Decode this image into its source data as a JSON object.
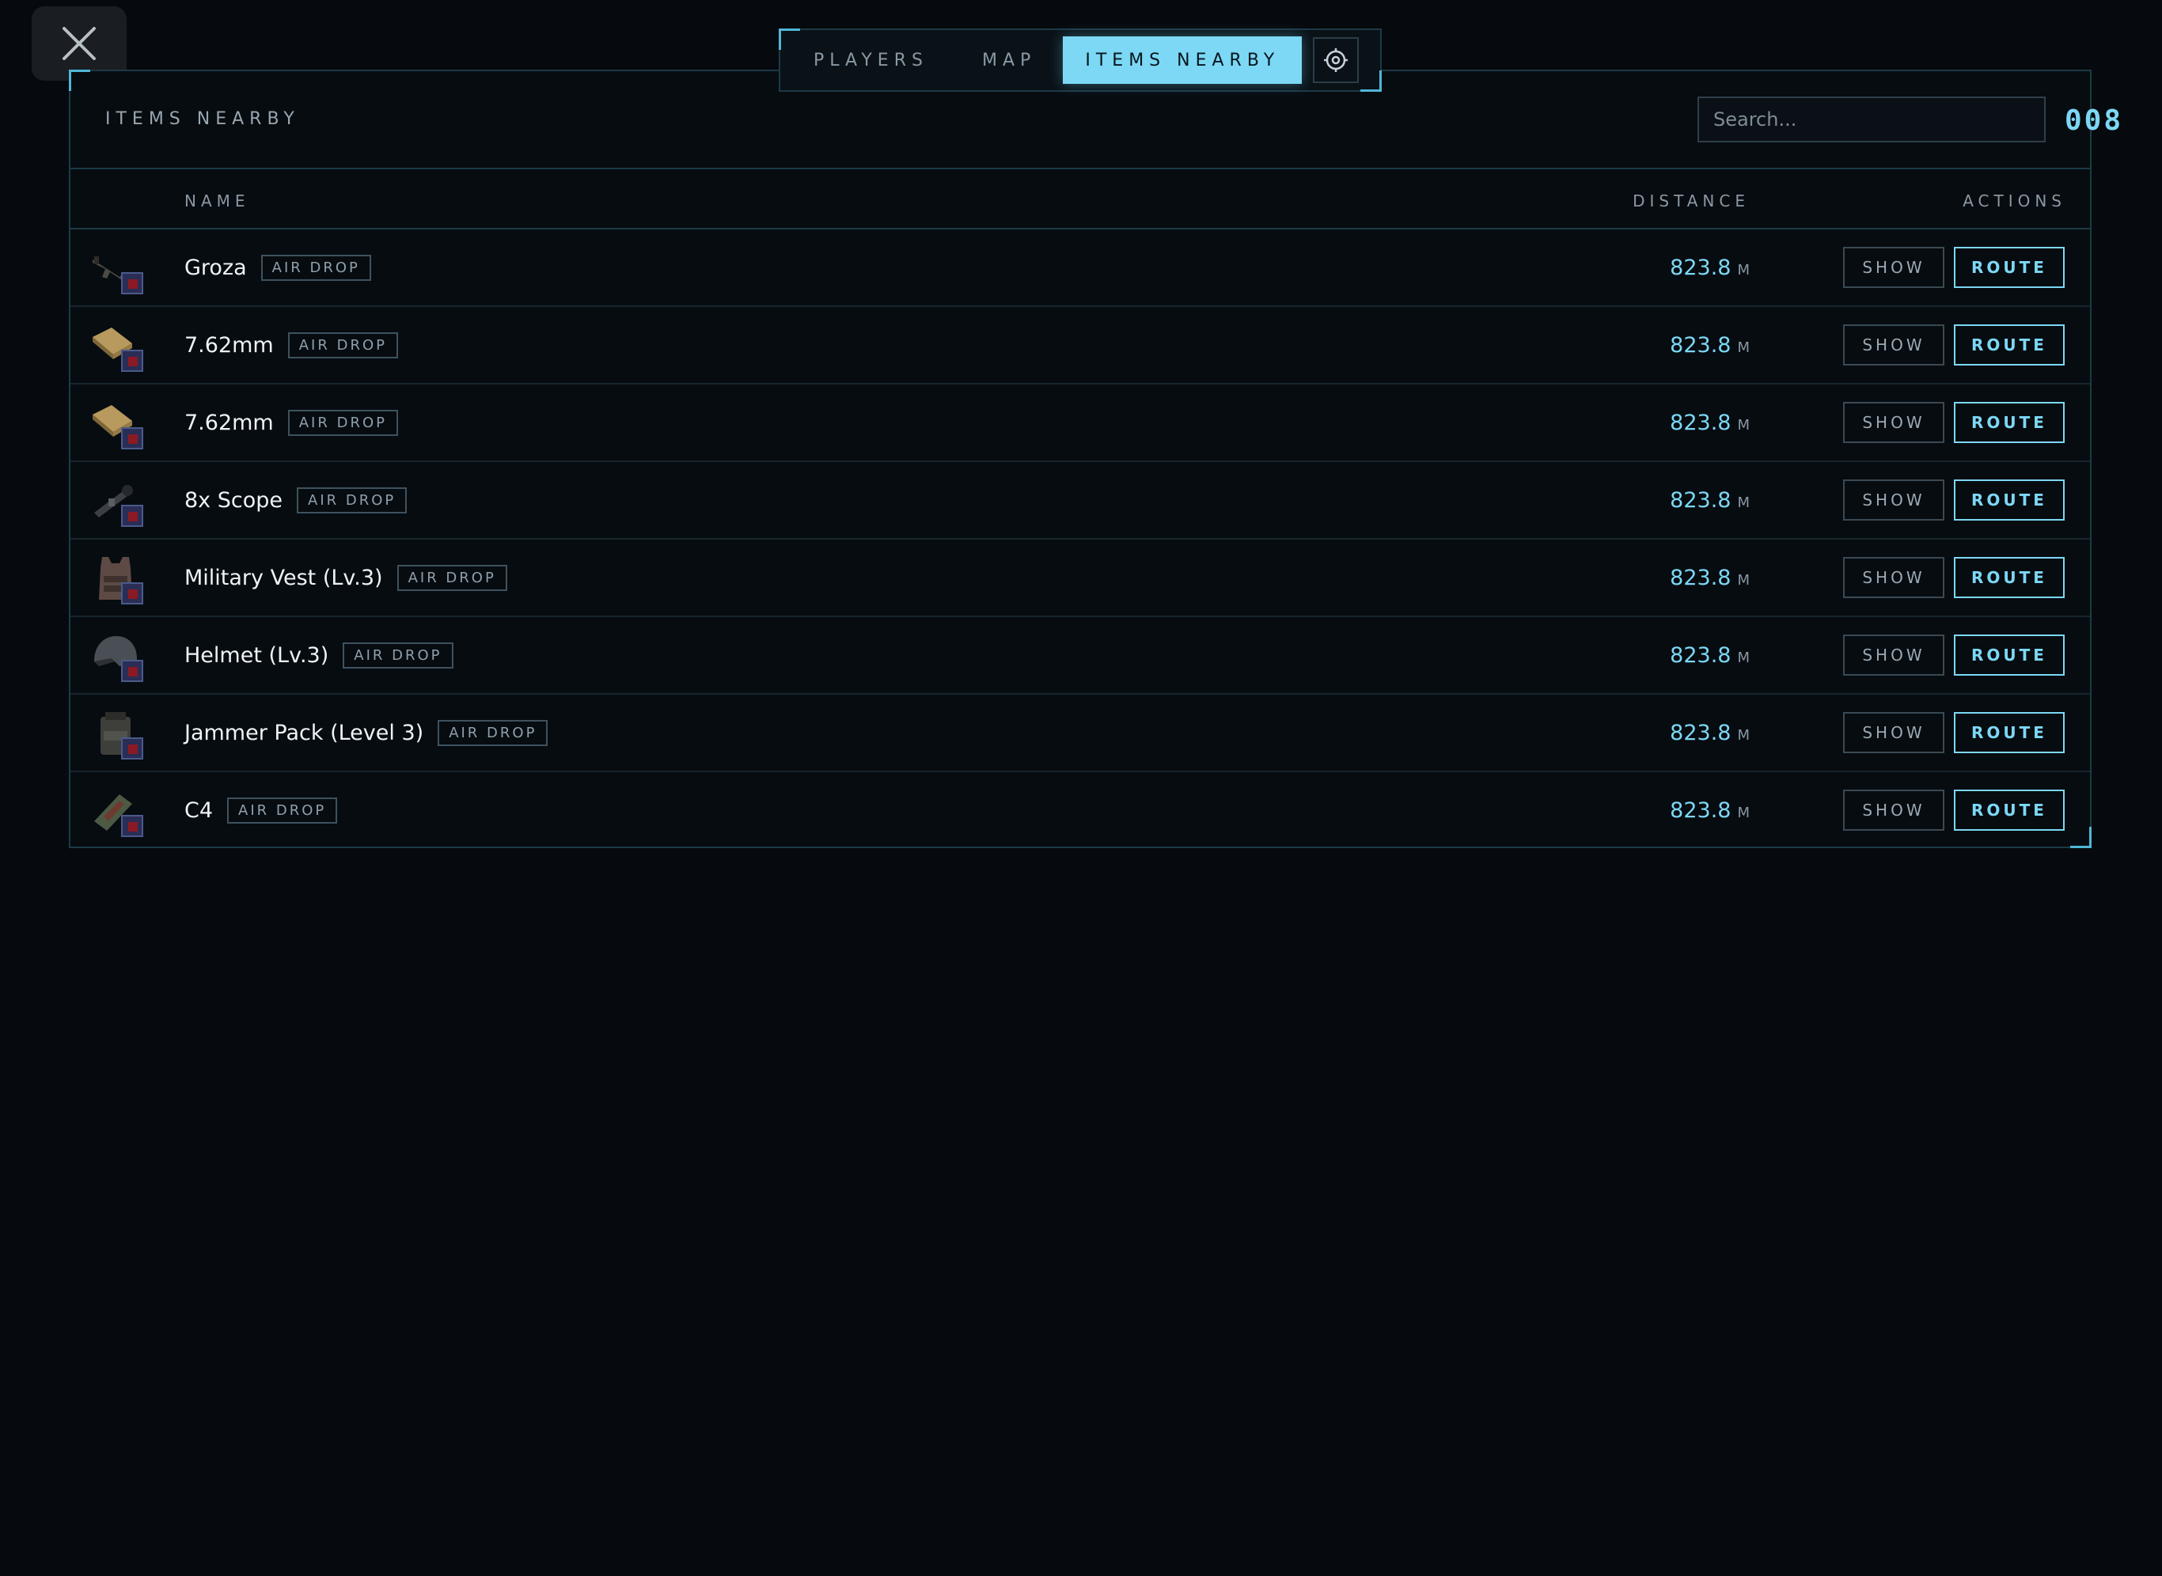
{
  "tabs": [
    {
      "label": "PLAYERS",
      "active": false
    },
    {
      "label": "MAP",
      "active": false
    },
    {
      "label": "ITEMS NEARBY",
      "active": true
    }
  ],
  "panel": {
    "title": "ITEMS NEARBY",
    "search_placeholder": "Search...",
    "count": "008"
  },
  "columns": {
    "name": "NAME",
    "distance": "DISTANCE",
    "actions": "ACTIONS"
  },
  "items": [
    {
      "name": "Groza",
      "tag": "AIR DROP",
      "distance": "823.8",
      "unit": "M",
      "icon": "rifle-icon",
      "show": "SHOW",
      "route": "ROUTE"
    },
    {
      "name": "7.62mm",
      "tag": "AIR DROP",
      "distance": "823.8",
      "unit": "M",
      "icon": "ammo-box-icon",
      "show": "SHOW",
      "route": "ROUTE"
    },
    {
      "name": "7.62mm",
      "tag": "AIR DROP",
      "distance": "823.8",
      "unit": "M",
      "icon": "ammo-box-icon",
      "show": "SHOW",
      "route": "ROUTE"
    },
    {
      "name": "8x Scope",
      "tag": "AIR DROP",
      "distance": "823.8",
      "unit": "M",
      "icon": "scope-icon",
      "show": "SHOW",
      "route": "ROUTE"
    },
    {
      "name": "Military Vest (Lv.3)",
      "tag": "AIR DROP",
      "distance": "823.8",
      "unit": "M",
      "icon": "vest-icon",
      "show": "SHOW",
      "route": "ROUTE"
    },
    {
      "name": "Helmet (Lv.3)",
      "tag": "AIR DROP",
      "distance": "823.8",
      "unit": "M",
      "icon": "helmet-icon",
      "show": "SHOW",
      "route": "ROUTE"
    },
    {
      "name": "Jammer Pack (Level 3)",
      "tag": "AIR DROP",
      "distance": "823.8",
      "unit": "M",
      "icon": "backpack-icon",
      "show": "SHOW",
      "route": "ROUTE"
    },
    {
      "name": "C4",
      "tag": "AIR DROP",
      "distance": "823.8",
      "unit": "M",
      "icon": "explosive-icon",
      "show": "SHOW",
      "route": "ROUTE"
    }
  ],
  "colors": {
    "accent": "#7cd8f5",
    "background": "#060a0e",
    "border": "#1d3a46"
  }
}
